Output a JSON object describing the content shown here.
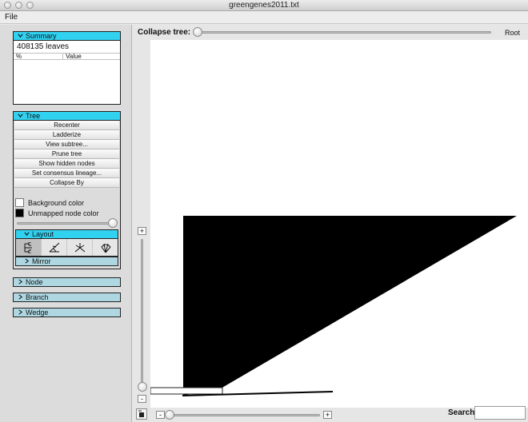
{
  "window": {
    "title": "greengenes2011.txt"
  },
  "menu": {
    "items": [
      "File"
    ]
  },
  "summary": {
    "header": "Summary",
    "leaf_count": "408135 leaves",
    "columns": [
      "%",
      "Value"
    ]
  },
  "tree": {
    "header": "Tree",
    "buttons": [
      "Recenter",
      "Ladderize",
      "View subtree...",
      "Prune tree",
      "Show hidden nodes",
      "Set consensus lineage...",
      "Collapse By"
    ],
    "background_color_label": "Background color",
    "unmapped_color_label": "Unmapped node color",
    "background_color": "#ffffff",
    "unmapped_color": "#000000",
    "size_slider_value": 1.0
  },
  "layout": {
    "header": "Layout",
    "icons": [
      "rectangular-layout-icon",
      "triangular-layout-icon",
      "unrooted-layout-icon",
      "radial-layout-icon"
    ],
    "selected": 0,
    "mirror_header": "Mirror"
  },
  "panels": {
    "node": "Node",
    "branch": "Branch",
    "wedge": "Wedge"
  },
  "canvas": {
    "collapse_label": "Collapse tree:",
    "collapse_value": 0,
    "root_label": "Root",
    "zoom_in": "+",
    "zoom_out": "-",
    "search_label": "Search:",
    "search_value": ""
  },
  "colors": {
    "open_header": "#31d1f0",
    "closed_header": "#aed7e2",
    "tree_fill": "#000000"
  }
}
